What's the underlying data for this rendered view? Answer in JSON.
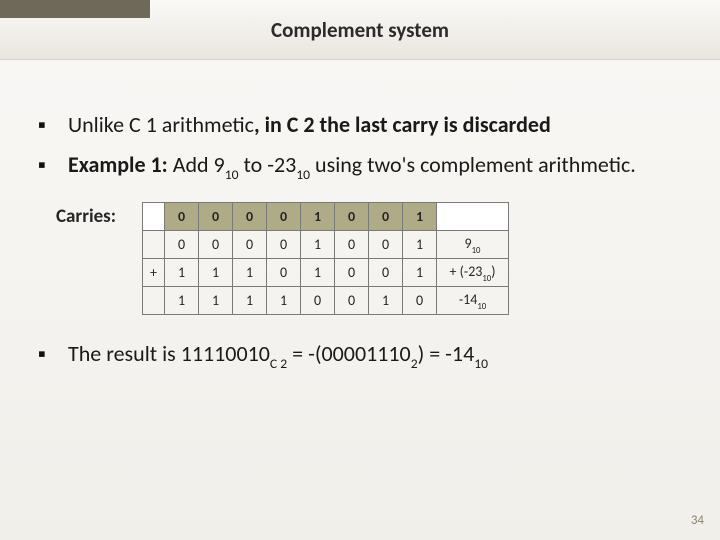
{
  "title": "Complement system",
  "bullets": {
    "b1_a": "Unlike C 1 arithmetic",
    "b1_b": ", in C 2 the last carry is discarded",
    "b2_a": "Example 1:",
    "b2_b": " Add 9",
    "b2_c": " to -23",
    "b2_d": " using two's complement arithmetic.",
    "sub10": "10"
  },
  "carries_label": "Carries:",
  "table": {
    "plus": "+",
    "row_carry": [
      "0",
      "0",
      "0",
      "0",
      "1",
      "0",
      "0",
      "1"
    ],
    "row_a": [
      "0",
      "0",
      "0",
      "0",
      "1",
      "0",
      "0",
      "1"
    ],
    "row_b": [
      "1",
      "1",
      "1",
      "0",
      "1",
      "0",
      "0",
      "1"
    ],
    "row_res": [
      "1",
      "1",
      "1",
      "1",
      "0",
      "0",
      "1",
      "0"
    ],
    "note_a_val": "9",
    "note_a_sub": "10",
    "note_b_pre": "+ (-23",
    "note_b_sub": "10",
    "note_b_post": ")",
    "note_r_val": "-14",
    "note_r_sub": "10"
  },
  "result": {
    "pre": "The result is 11110010",
    "sub1": "C 2",
    "mid": " = -(00001110",
    "sub2": "2",
    "mid2": ") = -14",
    "sub3": "10"
  },
  "page_number": "34",
  "chart_data": {
    "type": "table",
    "title": "Two's complement addition example: 9 + (-23) = -14",
    "rows": [
      {
        "label": "Carries",
        "bits": [
          0,
          0,
          0,
          0,
          1,
          0,
          0,
          1
        ]
      },
      {
        "label": "9 (base 10)",
        "bits": [
          0,
          0,
          0,
          0,
          1,
          0,
          0,
          1
        ]
      },
      {
        "label": "+ (-23 base 10)",
        "bits": [
          1,
          1,
          1,
          0,
          1,
          0,
          0,
          1
        ]
      },
      {
        "label": "-14 (base 10)",
        "bits": [
          1,
          1,
          1,
          1,
          0,
          0,
          1,
          0
        ]
      }
    ]
  }
}
